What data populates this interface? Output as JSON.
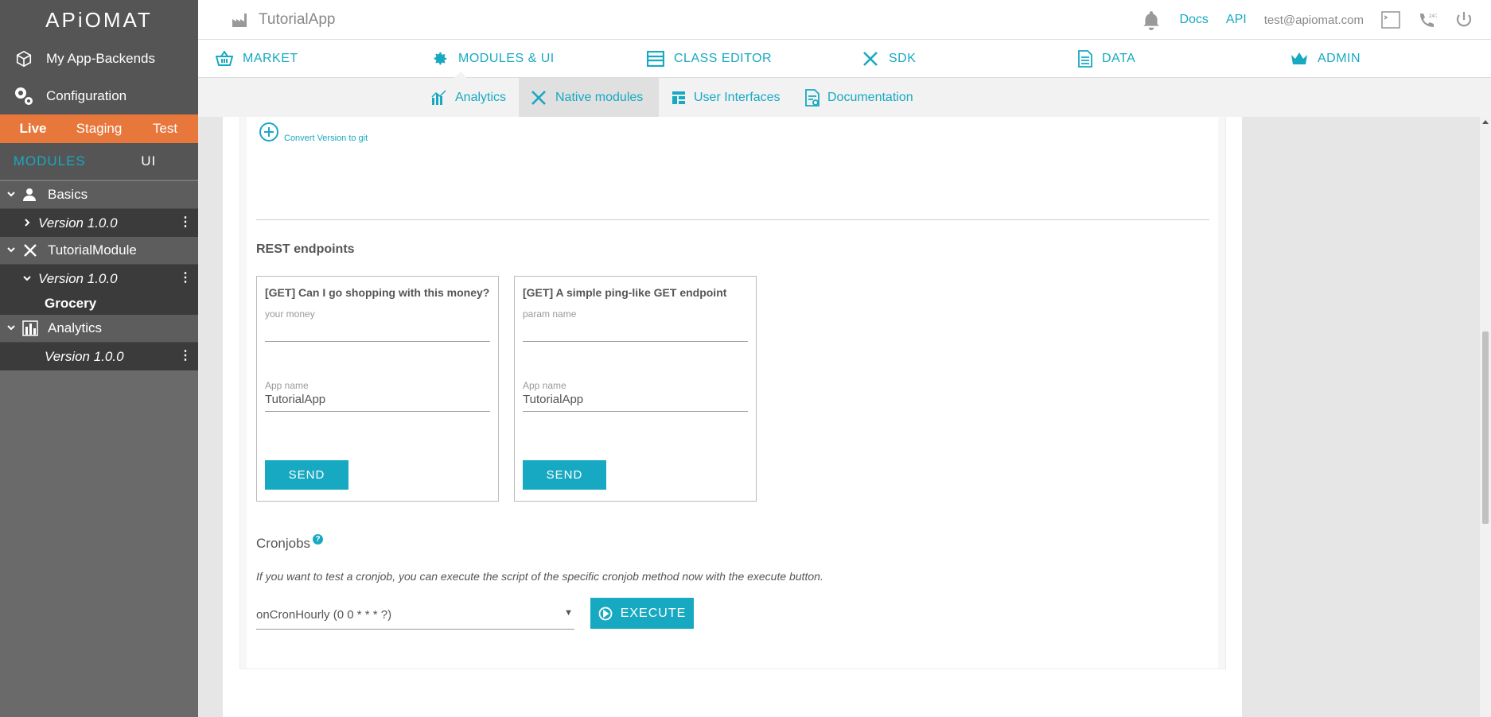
{
  "brand": {
    "logo_text": "APiOMAT",
    "accent": "#17a9c2",
    "env_color": "#e8773b"
  },
  "sidebar": {
    "links": [
      {
        "label": "My App-Backends",
        "icon": "cube-icon"
      },
      {
        "label": "Configuration",
        "icon": "gears-icon"
      }
    ],
    "env_tabs": [
      "Live",
      "Staging",
      "Test"
    ],
    "active_env": "Live",
    "module_tabs": [
      "MODULES",
      "UI"
    ],
    "active_module_tab": "MODULES",
    "tree": {
      "basics": {
        "label": "Basics",
        "version": "Version 1.0.0"
      },
      "tutorial": {
        "label": "TutorialModule",
        "version": "Version 1.0.0",
        "class": "Grocery"
      },
      "analytics": {
        "label": "Analytics",
        "version": "Version 1.0.0"
      }
    }
  },
  "header": {
    "app_title": "TutorialApp",
    "docs": "Docs",
    "api": "API",
    "email": "test@apiomat.com"
  },
  "mainnav": [
    "MARKET",
    "MODULES & UI",
    "CLASS EDITOR",
    "SDK",
    "DATA",
    "ADMIN"
  ],
  "subnav": [
    "Analytics",
    "Native modules",
    "User Interfaces",
    "Documentation"
  ],
  "content": {
    "convert_label": "Convert Version to git",
    "rest_title": "REST endpoints",
    "endpoints": [
      {
        "title": "[GET] Can I go shopping with this money?",
        "param_label": "your money",
        "param_value": "",
        "app_label": "App name",
        "app_value": "TutorialApp",
        "send": "SEND"
      },
      {
        "title": "[GET] A simple ping-like GET endpoint",
        "param_label": "param name",
        "param_value": "",
        "app_label": "App name",
        "app_value": "TutorialApp",
        "send": "SEND"
      }
    ],
    "cron": {
      "title": "Cronjobs",
      "help": "?",
      "description": "If you want to test a cronjob, you can execute the script of the specific cronjob method now with the execute button.",
      "selected": "onCronHourly (0 0 * * * ?)",
      "execute": "EXECUTE"
    }
  }
}
